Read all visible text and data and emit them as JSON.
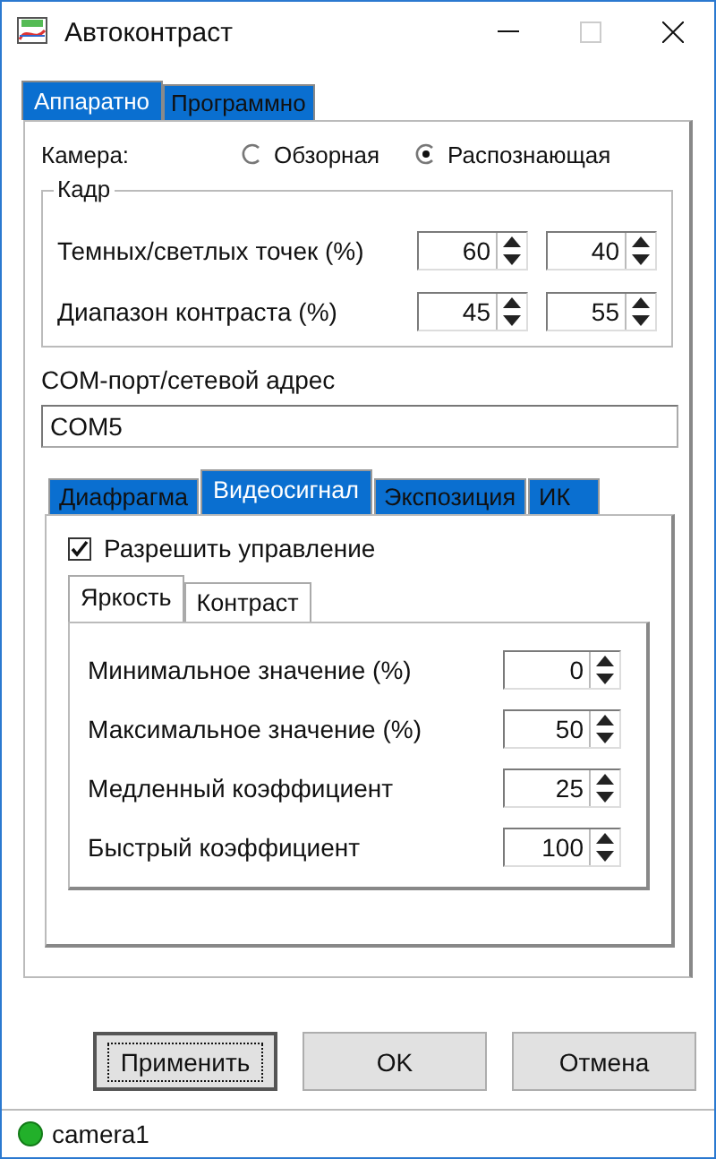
{
  "window": {
    "title": "Автоконтраст"
  },
  "tabs": [
    {
      "label": "Аппаратно",
      "selected": true
    },
    {
      "label": "Программно",
      "selected": false
    }
  ],
  "camera": {
    "label": "Камера:",
    "options": [
      {
        "label": "Обзорная",
        "selected": false
      },
      {
        "label": "Распознающая",
        "selected": true
      }
    ]
  },
  "frame": {
    "title": "Кадр",
    "rows": [
      {
        "label": "Темных/светлых точек (%)",
        "values": [
          "60",
          "40"
        ]
      },
      {
        "label": "Диапазон контраста (%)",
        "values": [
          "45",
          "55"
        ]
      }
    ]
  },
  "address": {
    "label": "COM-порт/сетевой адрес",
    "value": "COM5"
  },
  "sub_tabs": [
    {
      "label": "Диафрагма",
      "selected": false
    },
    {
      "label": "Видеосигнал",
      "selected": true
    },
    {
      "label": "Экспозиция",
      "selected": false
    },
    {
      "label": "ИК",
      "selected": false
    }
  ],
  "enable": {
    "label": "Разрешить управление",
    "checked": true
  },
  "inner_tabs": [
    {
      "label": "Яркость",
      "selected": true
    },
    {
      "label": "Контраст",
      "selected": false
    }
  ],
  "params": [
    {
      "label": "Минимальное значение (%)",
      "value": "0"
    },
    {
      "label": "Максимальное значение (%)",
      "value": "50"
    },
    {
      "label": "Медленный коэффициент",
      "value": "25"
    },
    {
      "label": "Быстрый коэффициент",
      "value": "100"
    }
  ],
  "buttons": [
    {
      "label": "Применить",
      "focused": true
    },
    {
      "label": "OK",
      "focused": false
    },
    {
      "label": "Отмена",
      "focused": false
    }
  ],
  "status_bar": {
    "text": "camera1",
    "online": true
  }
}
